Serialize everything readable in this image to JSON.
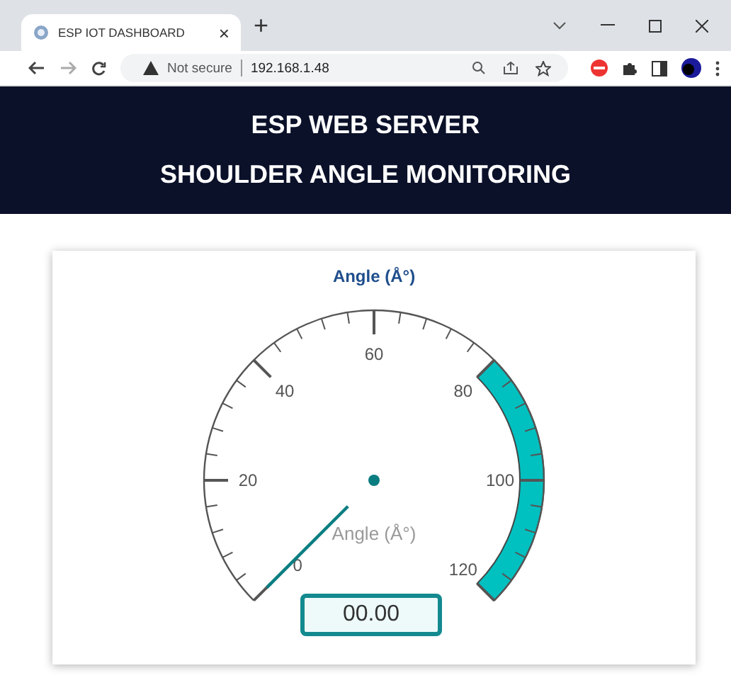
{
  "browser": {
    "tab_title": "ESP IOT DASHBOARD",
    "tab_close": "×",
    "new_tab": "+",
    "security": "Not secure",
    "url": "192.168.1.48"
  },
  "header": {
    "title": "ESP WEB SERVER",
    "subtitle": "SHOULDER ANGLE MONITORING"
  },
  "gauge": {
    "title": "Angle (Å°)",
    "units": "Angle (Å°)",
    "tick_labels": [
      "0",
      "20",
      "40",
      "60",
      "80",
      "100",
      "120"
    ],
    "value": "00.00"
  }
}
